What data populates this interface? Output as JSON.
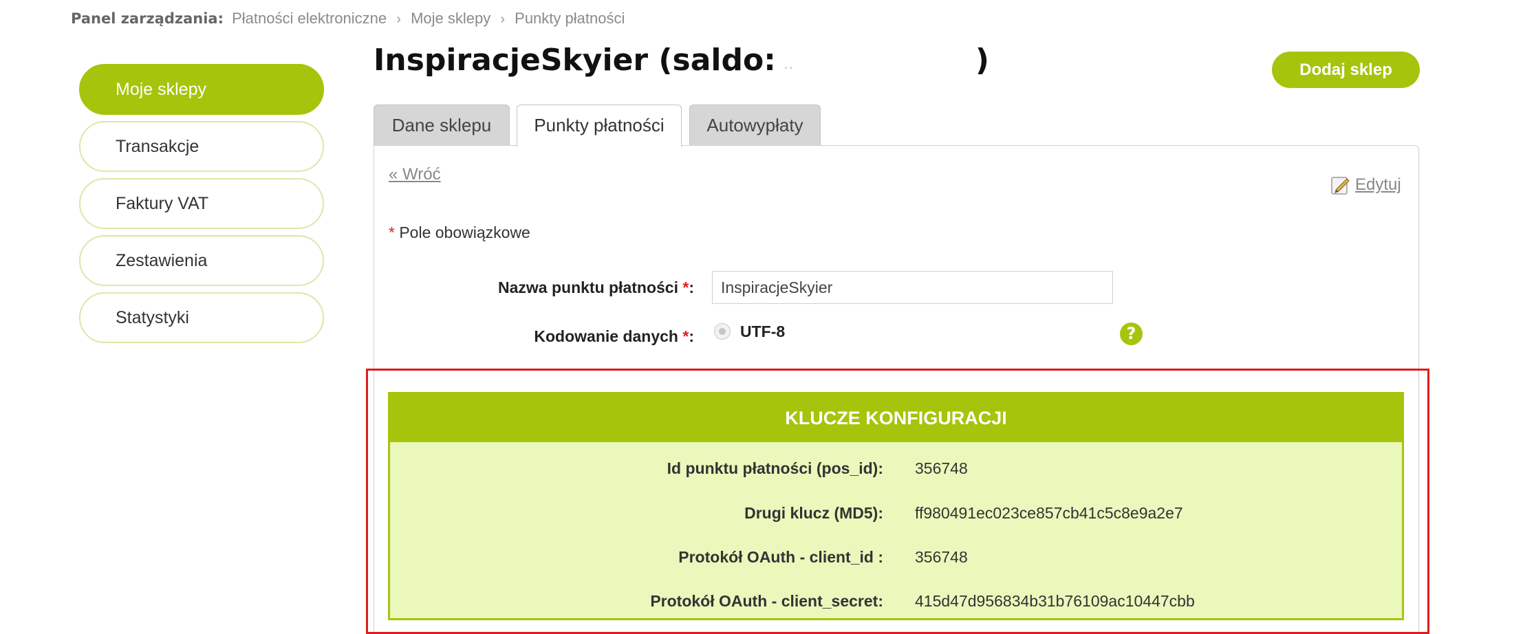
{
  "breadcrumb": {
    "lead": "Panel zarządzania:",
    "items": [
      "Płatności elektroniczne",
      "Moje sklepy",
      "Punkty płatności"
    ],
    "separator": "›"
  },
  "sidebar": {
    "items": [
      {
        "label": "Moje sklepy",
        "active": true
      },
      {
        "label": "Transakcje",
        "active": false
      },
      {
        "label": "Faktury VAT",
        "active": false
      },
      {
        "label": "Zestawienia",
        "active": false
      },
      {
        "label": "Statystyki",
        "active": false
      }
    ]
  },
  "header": {
    "title_prefix": "InspiracjeSkyier (saldo:",
    "title_suffix": ")",
    "add_shop_label": "Dodaj sklep"
  },
  "tabs": [
    {
      "label": "Dane sklepu",
      "active": false
    },
    {
      "label": "Punkty płatności",
      "active": true
    },
    {
      "label": "Autowypłaty",
      "active": false
    }
  ],
  "panel": {
    "back_label": "« Wróć",
    "edit_label": "Edytuj",
    "required_star": "*",
    "required_text": " Pole obowiązkowe"
  },
  "form": {
    "name_label": "Nazwa punktu płatności ",
    "name_value": "InspiracjeSkyier",
    "encoding_label": "Kodowanie danych ",
    "encoding_option": "UTF-8",
    "help_glyph": "?",
    "label_colon": ":"
  },
  "keys": {
    "title": "KLUCZE KONFIGURACJI",
    "rows": [
      {
        "label": "Id punktu płatności (pos_id):",
        "value": "356748"
      },
      {
        "label": "Drugi klucz (MD5):",
        "value": "ff980491ec023ce857cb41c5c8e9a2e7"
      },
      {
        "label": "Protokół OAuth - client_id :",
        "value": "356748"
      },
      {
        "label": "Protokół OAuth - client_secret:",
        "value": "415d47d956834b31b76109ac10447cbb"
      }
    ]
  },
  "colors": {
    "accent": "#a6c40b",
    "accent_light": "#eaf8bc",
    "highlight": "#e01b1b",
    "required": "#e02020"
  }
}
